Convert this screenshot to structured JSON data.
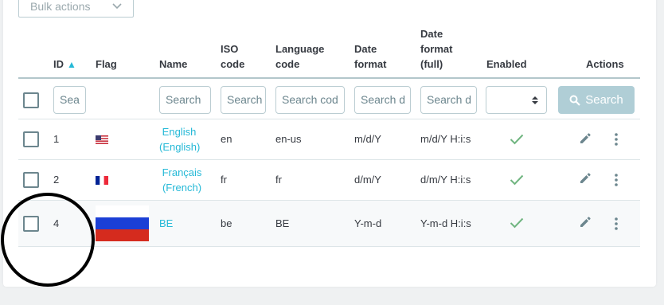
{
  "toolbar": {
    "bulk_label": "Bulk actions"
  },
  "table": {
    "headers": {
      "id": "ID",
      "flag": "Flag",
      "name": "Name",
      "iso_1": "ISO",
      "iso_2": "code",
      "lang_1": "Language",
      "lang_2": "code",
      "date_1": "Date",
      "date_2": "format",
      "datefull_1": "Date",
      "datefull_2": "format",
      "datefull_3": "(full)",
      "enabled": "Enabled",
      "actions": "Actions"
    },
    "filters": {
      "id_placeholder": "Sea",
      "name_placeholder": "Search",
      "iso_placeholder": "Search",
      "lang_placeholder": "Search cod",
      "date_placeholder": "Search d",
      "datefull_placeholder": "Search d",
      "search_button": "Search"
    },
    "rows": [
      {
        "id": "1",
        "name_1": "English",
        "name_2": "(English)",
        "iso": "en",
        "lang": "en-us",
        "date": "m/d/Y",
        "datefull": "m/d/Y H:i:s",
        "enabled": true
      },
      {
        "id": "2",
        "name_1": "Français",
        "name_2": "(French)",
        "iso": "fr",
        "lang": "fr",
        "date": "d/m/Y",
        "datefull": "d/m/Y H:i:s",
        "enabled": true
      },
      {
        "id": "4",
        "name_1": "BE",
        "name_2": "",
        "iso": "be",
        "lang": "BE",
        "date": "Y-m-d",
        "datefull": "Y-m-d H:i:s",
        "enabled": true
      }
    ]
  },
  "colors": {
    "accent": "#25b9d7",
    "success": "#70b580",
    "search_button_bg": "#b0ced6"
  },
  "icons": [
    "chevron-down-icon",
    "sort-asc-icon",
    "select-caret-icon",
    "search-icon",
    "check-icon",
    "edit-icon",
    "more-vert-icon",
    "flag-us-icon",
    "flag-fr-icon",
    "flag-ru-icon"
  ]
}
